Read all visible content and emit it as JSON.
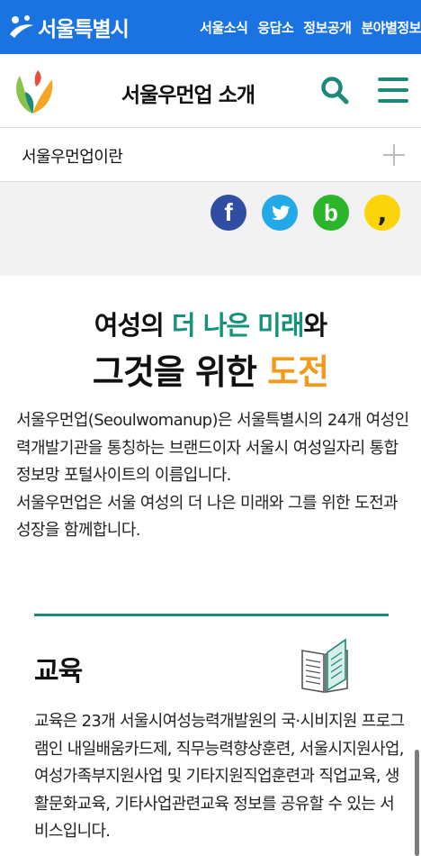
{
  "topbar": {
    "logo_text": "서울특별시",
    "links": [
      "서울소식",
      "응답소",
      "정보공개",
      "분야별정보"
    ]
  },
  "header": {
    "title": "서울우먼업 소개"
  },
  "accordion": {
    "label": "서울우먼업이란"
  },
  "share": {
    "icons": [
      "facebook-icon",
      "twitter-icon",
      "blog-icon",
      "kakaostory-icon"
    ],
    "facebook_glyph": "f",
    "blog_glyph": "b",
    "kakao_glyph": ","
  },
  "headline": {
    "line1_prefix": "여성의 ",
    "line1_highlight": "더 나은 미래",
    "line1_suffix": "와",
    "line2_prefix": "그것을 위한 ",
    "line2_highlight": "도전"
  },
  "intro": {
    "paragraph1": "서울우먼업(Seoulwomanup)은 서울특별시의 24개 여성인력개발기관을 통칭하는 브랜드이자 서울시 여성일자리 통합정보망 포털사이트의 이름입니다.",
    "paragraph2": "서울우먼업은 서울 여성의 더 나은 미래와 그를 위한 도전과 성장을 함께합니다."
  },
  "section": {
    "title": "교육",
    "text": "교육은 23개 서울시여성능력개발원의 국·시비지원 프로그램인 내일배움카드제, 직무능력향상훈련, 서울시지원사업, 여성가족부지원사업 및 기타지원직업훈련과 직업교육, 생활문화교육, 기타사업관련교육 정보를 공유할 수 있는 서비스입니다."
  },
  "colors": {
    "topbar": "#1a73e0",
    "accent_teal": "#16927c",
    "accent_orange": "#f39a1c",
    "facebook": "#2f4ea3",
    "twitter": "#23a9e8",
    "blog": "#2ab52a",
    "kakao": "#fbd40a"
  }
}
